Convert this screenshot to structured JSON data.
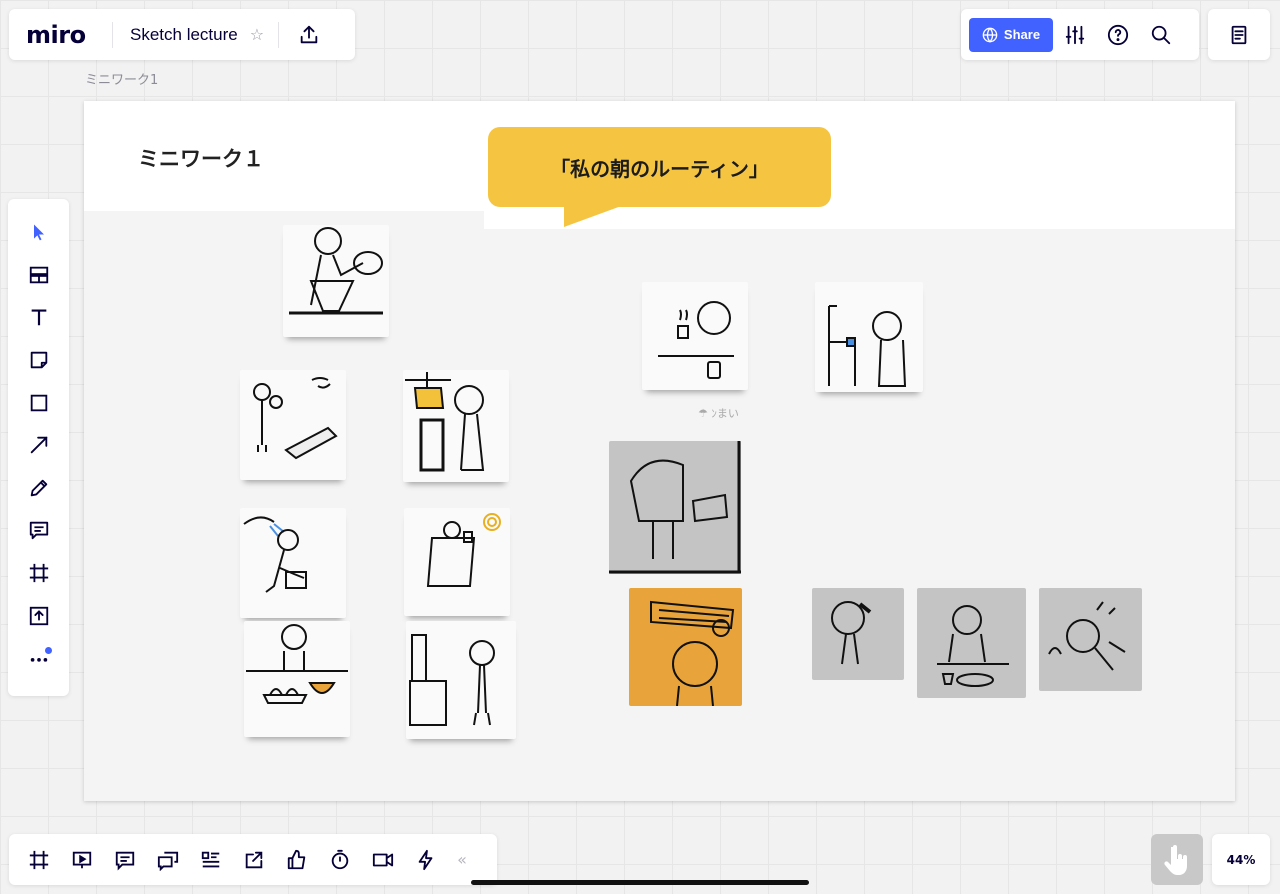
{
  "app": {
    "logo": "miro",
    "board_title": "Sketch lecture"
  },
  "topbar": {
    "share_label": "Share"
  },
  "frame": {
    "label": "ミニワーク1",
    "title": "ミニワーク１",
    "bubble_text": "「私の朝のルーティン」"
  },
  "left_toolbar": {
    "tools": [
      "select-icon",
      "templates-icon",
      "text-icon",
      "sticky-note-icon",
      "shape-icon",
      "connector-arrow-icon",
      "pen-icon",
      "comment-icon",
      "frame-icon",
      "upload-icon",
      "more-icon"
    ]
  },
  "bottom_toolbar": {
    "tools": [
      "frames-icon",
      "presentation-icon",
      "comments-icon",
      "video-chat-icon",
      "card-list-icon",
      "screen-share-icon",
      "voting-icon",
      "timer-icon",
      "video-call-icon",
      "activity-icon"
    ],
    "collapse_label": "«"
  },
  "zoom": {
    "level": "44%"
  },
  "colors": {
    "accent": "#4262ff",
    "bubble": "#f5c542",
    "logo": "#050038"
  }
}
